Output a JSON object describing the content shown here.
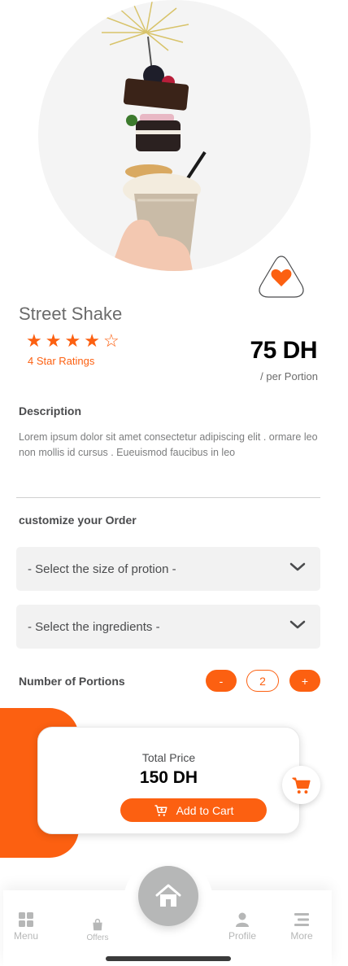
{
  "product": {
    "title": "Street Shake",
    "rating_stars": 4,
    "rating_max": 5,
    "ratings_text": "4 Star Ratings",
    "price": "75 DH",
    "price_unit": "/ per Portion"
  },
  "description": {
    "heading": "Description",
    "text": "Lorem ipsum dolor sit amet consectetur adipiscing elit . ormare leo non mollis id cursus . Eueuismod faucibus in leo"
  },
  "customize": {
    "heading": "customize your Order",
    "size_select": "- Select the size of protion -",
    "ingredients_select": "- Select the ingredients -",
    "portions_label": "Number of Portions",
    "minus_label": "-",
    "plus_label": "+",
    "portions_count": "2"
  },
  "total": {
    "label": "Total Price",
    "value": "150 DH",
    "add_to_cart": "Add to Cart"
  },
  "tabbar": {
    "menu": "Menu",
    "offers": "Offers",
    "profile": "Profile",
    "more": "More"
  },
  "colors": {
    "accent": "#fc6011",
    "inactive": "#b6b7b7",
    "text": "#4a4b4d"
  },
  "icons": [
    "heart-icon",
    "star-icon",
    "chevron-down-icon",
    "cart-icon",
    "menu-grid-icon",
    "offers-bag-icon",
    "home-icon",
    "profile-icon",
    "more-list-icon"
  ]
}
